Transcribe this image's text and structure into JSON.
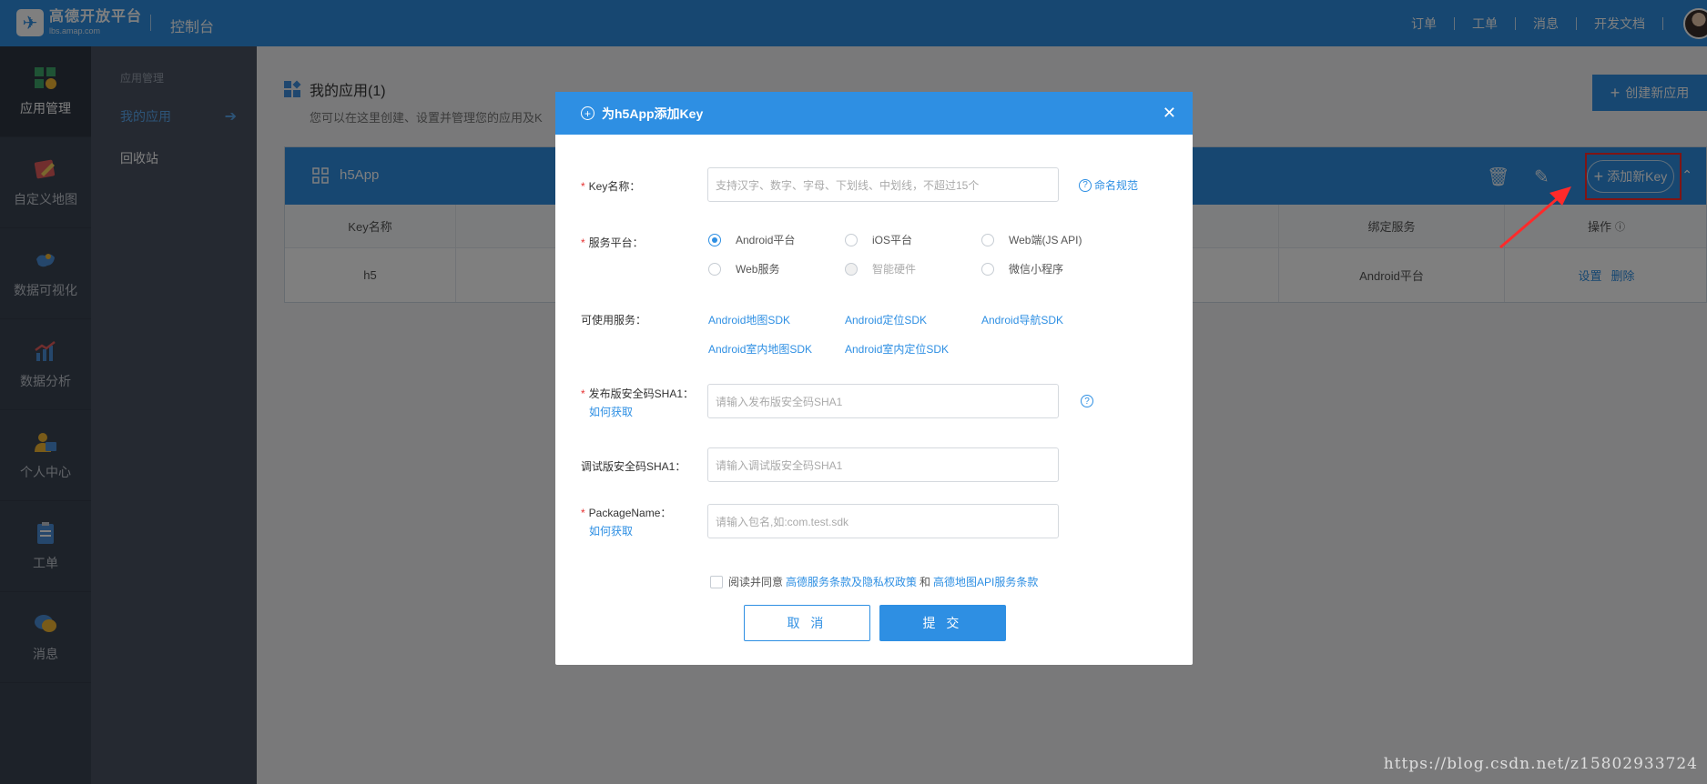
{
  "topbar": {
    "logo_mark": "✈",
    "logo_title": "高德开放平台",
    "logo_url": "lbs.amap.com",
    "console": "控制台",
    "nav": [
      "订单",
      "工单",
      "消息",
      "开发文档"
    ]
  },
  "leftnav": {
    "items": [
      {
        "label": "应用管理",
        "icon": "app-grid-icon"
      },
      {
        "label": "自定义地图",
        "icon": "custom-map-icon"
      },
      {
        "label": "数据可视化",
        "icon": "data-visual-icon"
      },
      {
        "label": "数据分析",
        "icon": "data-analysis-icon"
      },
      {
        "label": "个人中心",
        "icon": "user-center-icon"
      },
      {
        "label": "工单",
        "icon": "ticket-icon"
      },
      {
        "label": "消息",
        "icon": "message-icon"
      }
    ]
  },
  "subnav": {
    "group_title": "应用管理",
    "items": [
      "我的应用",
      "回收站"
    ]
  },
  "main": {
    "title": "我的应用(1)",
    "subtitle": "您可以在这里创建、设置并管理您的应用及K",
    "create_button": "创建新应用",
    "app": {
      "name": "h5App",
      "add_key_button": "添加新Key",
      "columns": [
        "Key名称",
        "绑定服务",
        "操作"
      ],
      "rows": [
        {
          "key_name": "h5",
          "service": "Android平台",
          "ops": [
            "设置",
            "删除"
          ]
        }
      ]
    }
  },
  "modal": {
    "title": "为h5App添加Key",
    "key_name_label": "Key名称：",
    "key_name_placeholder": "支持汉字、数字、字母、下划线、中划线，不超过15个",
    "naming_rules_link": "命名规范",
    "platform_label": "服务平台：",
    "platforms": [
      {
        "label": "Android平台",
        "checked": true,
        "disabled": false
      },
      {
        "label": "iOS平台",
        "checked": false,
        "disabled": false
      },
      {
        "label": "Web端(JS API)",
        "checked": false,
        "disabled": false
      },
      {
        "label": "Web服务",
        "checked": false,
        "disabled": false
      },
      {
        "label": "智能硬件",
        "checked": false,
        "disabled": true
      },
      {
        "label": "微信小程序",
        "checked": false,
        "disabled": false
      }
    ],
    "services_label": "可使用服务：",
    "services": [
      "Android地图SDK",
      "Android定位SDK",
      "Android导航SDK",
      "Android室内地图SDK",
      "Android室内定位SDK"
    ],
    "release_sha1_label": "发布版安全码SHA1：",
    "release_sha1_placeholder": "请输入发布版安全码SHA1",
    "how_to_get": "如何获取",
    "debug_sha1_label": "调试版安全码SHA1：",
    "debug_sha1_placeholder": "请输入调试版安全码SHA1",
    "package_label": "PackageName：",
    "package_placeholder": "请输入包名,如:com.test.sdk",
    "agree_prefix": "阅读并同意",
    "agree_link1": "高德服务条款及隐私权政策",
    "agree_and": "和",
    "agree_link2": "高德地图API服务条款",
    "cancel_button": "取 消",
    "submit_button": "提 交"
  },
  "watermark": "https://blog.csdn.net/z15802933724",
  "colors": {
    "primary": "#2e8fe3",
    "sidebar": "#3b4452",
    "subnav": "#4a5363",
    "highlight": "#ff2a2a"
  }
}
